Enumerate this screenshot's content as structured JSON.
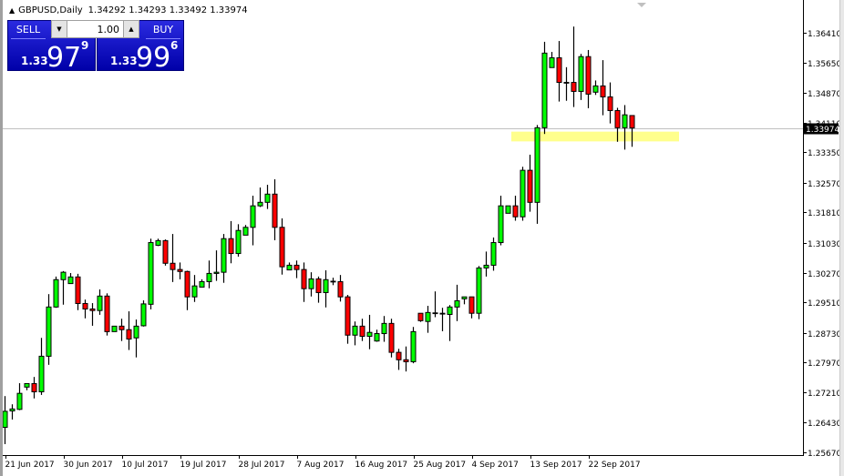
{
  "header": {
    "symbol": "GBPUSD,Daily",
    "ohlc": "1.34292 1.34293 1.33492 1.33974"
  },
  "trade_panel": {
    "sell_label": "SELL",
    "buy_label": "BUY",
    "lot_value": "1.00",
    "sell_price": {
      "prefix": "1.33",
      "main": "97",
      "sup": "9"
    },
    "buy_price": {
      "prefix": "1.33",
      "main": "99",
      "sup": "6"
    }
  },
  "colors": {
    "bull": "#00ff00",
    "bear": "#ff0000",
    "highlight_zone": "#ffff80",
    "sell_bg": "#0000c0"
  },
  "chart_data": {
    "type": "candlestick",
    "title": "GBPUSD,Daily",
    "ylim": [
      1.256,
      1.3725
    ],
    "current_price": "1.33974",
    "current_price_value": 1.33974,
    "highlight_zone": [
      1.3363,
      1.3388
    ],
    "yticks": [
      "1.36410",
      "1.35650",
      "1.34870",
      "1.34110",
      "1.33350",
      "1.32570",
      "1.31810",
      "1.31030",
      "1.30270",
      "1.29510",
      "1.28730",
      "1.27970",
      "1.27210",
      "1.26430",
      "1.25670"
    ],
    "xticks": [
      {
        "label": "21 Jun 2017",
        "index": 0
      },
      {
        "label": "30 Jun 2017",
        "index": 8
      },
      {
        "label": "10 Jul 2017",
        "index": 16
      },
      {
        "label": "19 Jul 2017",
        "index": 24
      },
      {
        "label": "28 Jul 2017",
        "index": 32
      },
      {
        "label": "7 Aug 2017",
        "index": 40
      },
      {
        "label": "16 Aug 2017",
        "index": 48
      },
      {
        "label": "25 Aug 2017",
        "index": 56
      },
      {
        "label": "4 Sep 2017",
        "index": 64
      },
      {
        "label": "13 Sep 2017",
        "index": 72
      },
      {
        "label": "22 Sep 2017",
        "index": 80
      }
    ],
    "ohlc": [
      [
        1.2631,
        1.2711,
        1.2588,
        1.2672
      ],
      [
        1.2673,
        1.269,
        1.2651,
        1.2678
      ],
      [
        1.2677,
        1.2744,
        1.2675,
        1.2718
      ],
      [
        1.2734,
        1.2743,
        1.2726,
        1.2743
      ],
      [
        1.2743,
        1.276,
        1.2705,
        1.2722
      ],
      [
        1.2722,
        1.286,
        1.2714,
        1.2813
      ],
      [
        1.2813,
        1.2972,
        1.2791,
        1.2939
      ],
      [
        1.2939,
        1.3017,
        1.2937,
        1.3009
      ],
      [
        1.3009,
        1.3031,
        1.2945,
        1.3028
      ],
      [
        1.2999,
        1.3026,
        1.2999,
        1.3016
      ],
      [
        1.3016,
        1.3024,
        1.2931,
        1.2948
      ],
      [
        1.2948,
        1.2958,
        1.291,
        1.2934
      ],
      [
        1.2934,
        1.2949,
        1.2891,
        1.293
      ],
      [
        1.293,
        1.2984,
        1.2919,
        1.2967
      ],
      [
        1.2967,
        1.2974,
        1.2866,
        1.2876
      ],
      [
        1.2876,
        1.289,
        1.2876,
        1.289
      ],
      [
        1.289,
        1.2909,
        1.2852,
        1.2881
      ],
      [
        1.2881,
        1.2928,
        1.2829,
        1.2857
      ],
      [
        1.286,
        1.2907,
        1.281,
        1.289
      ],
      [
        1.2891,
        1.2956,
        1.2889,
        1.2947
      ],
      [
        1.2946,
        1.3114,
        1.2933,
        1.3104
      ],
      [
        1.3097,
        1.3114,
        1.3095,
        1.3109
      ],
      [
        1.3109,
        1.3112,
        1.3045,
        1.3051
      ],
      [
        1.3051,
        1.3126,
        1.3003,
        1.3035
      ],
      [
        1.3035,
        1.3053,
        1.301,
        1.303
      ],
      [
        1.303,
        1.3032,
        1.2931,
        1.2965
      ],
      [
        1.2965,
        1.3021,
        1.2952,
        1.2993
      ],
      [
        1.299,
        1.301,
        1.299,
        1.3004
      ],
      [
        1.3004,
        1.3058,
        1.2987,
        1.3025
      ],
      [
        1.3025,
        1.3084,
        1.3006,
        1.3028
      ],
      [
        1.3028,
        1.3126,
        1.3001,
        1.3114
      ],
      [
        1.3114,
        1.3159,
        1.3051,
        1.3076
      ],
      [
        1.3076,
        1.3151,
        1.3068,
        1.3135
      ],
      [
        1.3123,
        1.3149,
        1.3123,
        1.3143
      ],
      [
        1.3143,
        1.3224,
        1.3097,
        1.3198
      ],
      [
        1.3198,
        1.3245,
        1.3195,
        1.3207
      ],
      [
        1.3207,
        1.3252,
        1.319,
        1.3228
      ],
      [
        1.3228,
        1.3266,
        1.311,
        1.3143
      ],
      [
        1.3143,
        1.3166,
        1.3022,
        1.3042
      ],
      [
        1.3034,
        1.3053,
        1.3034,
        1.3046
      ],
      [
        1.3046,
        1.3058,
        1.3013,
        1.3035
      ],
      [
        1.3035,
        1.3053,
        1.2952,
        1.2986
      ],
      [
        1.2986,
        1.3028,
        1.2966,
        1.3011
      ],
      [
        1.3011,
        1.3017,
        1.295,
        1.2976
      ],
      [
        1.2976,
        1.3033,
        1.2938,
        1.3009
      ],
      [
        1.3005,
        1.3014,
        1.2995,
        1.3004
      ],
      [
        1.3004,
        1.3021,
        1.2953,
        1.2965
      ],
      [
        1.2965,
        1.297,
        1.2845,
        1.2867
      ],
      [
        1.2867,
        1.2902,
        1.2841,
        1.289
      ],
      [
        1.289,
        1.2909,
        1.2852,
        1.2864
      ],
      [
        1.2864,
        1.2919,
        1.2831,
        1.2874
      ],
      [
        1.2852,
        1.2881,
        1.285,
        1.2871
      ],
      [
        1.2871,
        1.2916,
        1.285,
        1.2897
      ],
      [
        1.2897,
        1.2909,
        1.281,
        1.2823
      ],
      [
        1.2823,
        1.2832,
        1.2778,
        1.2804
      ],
      [
        1.2804,
        1.2838,
        1.2774,
        1.2799
      ],
      [
        1.2799,
        1.2888,
        1.2795,
        1.2876
      ],
      [
        1.2923,
        1.2923,
        1.2901,
        1.2904
      ],
      [
        1.2902,
        1.2942,
        1.2873,
        1.2925
      ],
      [
        1.2923,
        1.2979,
        1.2913,
        1.2924
      ],
      [
        1.2923,
        1.2937,
        1.2877,
        1.2921
      ],
      [
        1.292,
        1.2944,
        1.2852,
        1.2939
      ],
      [
        1.2939,
        1.2996,
        1.2903,
        1.2955
      ],
      [
        1.296,
        1.2965,
        1.2946,
        1.2965
      ],
      [
        1.2965,
        1.2965,
        1.291,
        1.2923
      ],
      [
        1.2923,
        1.3044,
        1.2908,
        1.3039
      ],
      [
        1.3039,
        1.3081,
        1.3017,
        1.3046
      ],
      [
        1.3046,
        1.3117,
        1.3032,
        1.3104
      ],
      [
        1.3104,
        1.3224,
        1.3097,
        1.3198
      ],
      [
        1.3179,
        1.3198,
        1.3179,
        1.3198
      ],
      [
        1.3198,
        1.3224,
        1.316,
        1.317
      ],
      [
        1.317,
        1.3298,
        1.316,
        1.3289
      ],
      [
        1.3289,
        1.3329,
        1.3183,
        1.3207
      ],
      [
        1.3207,
        1.3405,
        1.3152,
        1.3398
      ],
      [
        1.3398,
        1.3618,
        1.3382,
        1.3589
      ],
      [
        1.3552,
        1.3592,
        1.3552,
        1.3577
      ],
      [
        1.3577,
        1.362,
        1.3465,
        1.3514
      ],
      [
        1.3514,
        1.3553,
        1.3467,
        1.3513
      ],
      [
        1.3514,
        1.3657,
        1.3451,
        1.3491
      ],
      [
        1.3491,
        1.3587,
        1.3469,
        1.358
      ],
      [
        1.358,
        1.3597,
        1.3448,
        1.3484
      ],
      [
        1.3489,
        1.3519,
        1.3482,
        1.3505
      ],
      [
        1.3505,
        1.3571,
        1.343,
        1.3477
      ],
      [
        1.3477,
        1.3514,
        1.3409,
        1.3442
      ],
      [
        1.3442,
        1.3449,
        1.3362,
        1.3398
      ],
      [
        1.3398,
        1.3456,
        1.3342,
        1.3431
      ],
      [
        1.34292,
        1.34293,
        1.33492,
        1.33974
      ]
    ]
  }
}
